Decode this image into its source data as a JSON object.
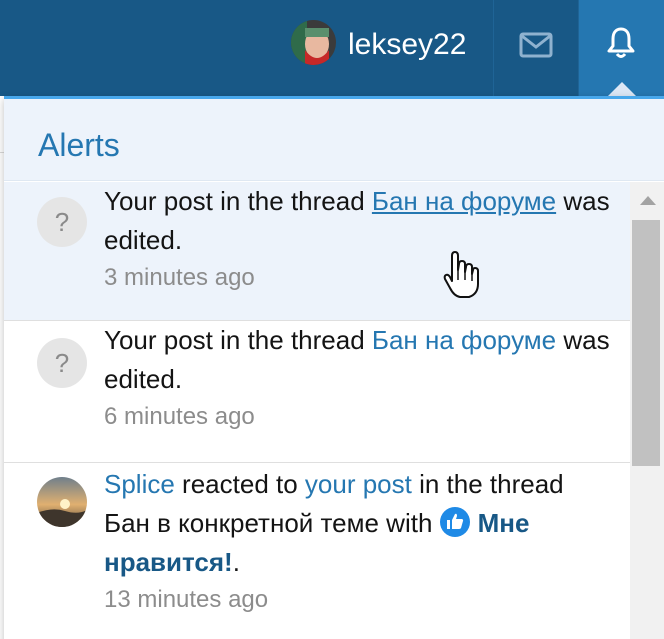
{
  "topbar": {
    "username": "leksey22",
    "icons": {
      "mail": "envelope-icon",
      "alerts": "bell-icon"
    },
    "colors": {
      "bar": "#185886",
      "active": "#2577b1"
    }
  },
  "alerts_menu": {
    "title": "Alerts",
    "items": [
      {
        "avatar": "?",
        "prefix": "Your post in the thread ",
        "thread": "Бан на форуме",
        "suffix": " was edited.",
        "time": "3 minutes ago",
        "state": "hovered"
      },
      {
        "avatar": "?",
        "prefix": "Your post in the thread ",
        "thread": "Бан на форуме",
        "suffix": " was edited.",
        "time": "6 minutes ago"
      },
      {
        "user": "Splice",
        "text1": " reacted to ",
        "post_link": "your post",
        "text2": " in the thread Бан в конкретной теме with ",
        "reaction": "Мне нравится!",
        "end": ".",
        "time": "13 minutes ago"
      }
    ]
  },
  "colors": {
    "link": "#2577b1",
    "accent": "#47a7eb",
    "muted": "#8c8c8c"
  }
}
